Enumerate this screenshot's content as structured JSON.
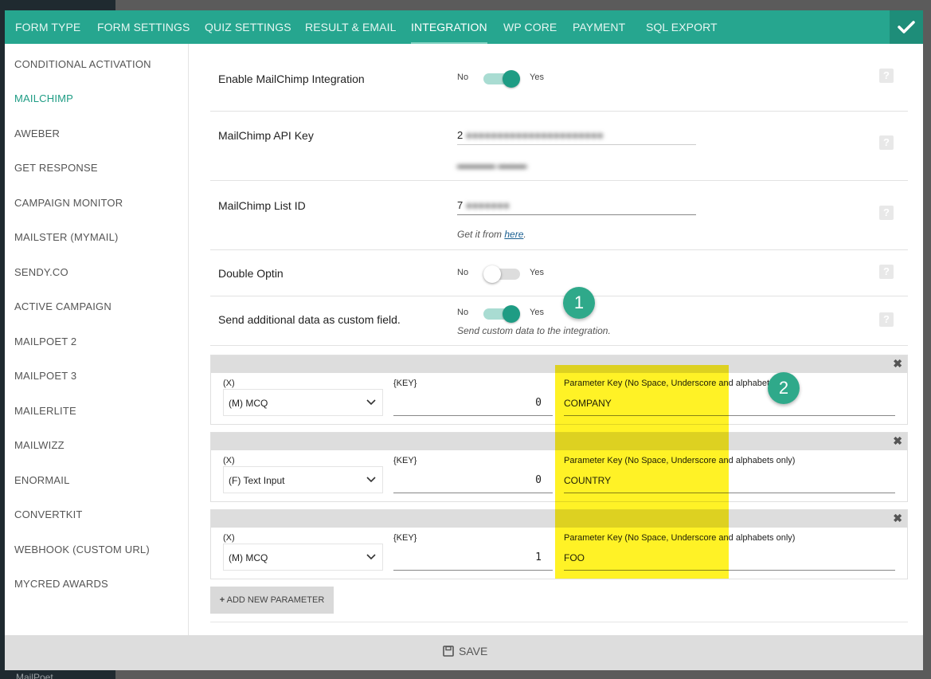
{
  "tabs": [
    {
      "label": "FORM TYPE"
    },
    {
      "label": "FORM SETTINGS"
    },
    {
      "label": "QUIZ SETTINGS"
    },
    {
      "label": "RESULT & EMAIL"
    },
    {
      "label": "INTEGRATION",
      "active": true
    },
    {
      "label": "WP CORE"
    },
    {
      "label": "PAYMENT"
    },
    {
      "label": "SQL EXPORT"
    }
  ],
  "confirm_icon": "check-icon",
  "sidebar": {
    "active": "MAILCHIMP",
    "items": [
      {
        "label": "CONDITIONAL ACTIVATION"
      },
      {
        "label": "MAILCHIMP"
      },
      {
        "label": "AWEBER"
      },
      {
        "label": "GET RESPONSE"
      },
      {
        "label": "CAMPAIGN MONITOR"
      },
      {
        "label": "MAILSTER (MYMAIL)"
      },
      {
        "label": "SENDY.CO"
      },
      {
        "label": "ACTIVE CAMPAIGN"
      },
      {
        "label": "MAILPOET 2"
      },
      {
        "label": "MAILPOET 3"
      },
      {
        "label": "MAILERLITE"
      },
      {
        "label": "MAILWIZZ"
      },
      {
        "label": "ENORMAIL"
      },
      {
        "label": "CONVERTKIT"
      },
      {
        "label": "WEBHOOK (CUSTOM URL)"
      },
      {
        "label": "MYCRED AWARDS"
      }
    ]
  },
  "settings": {
    "enable": {
      "label": "Enable MailChimp Integration",
      "no": "No",
      "yes": "Yes",
      "value": true
    },
    "api_key": {
      "label": "MailChimp API Key",
      "value": "2"
    },
    "list_id": {
      "label": "MailChimp List ID",
      "value": "7",
      "helper_prefix": "Get it from ",
      "helper_link": "here",
      "helper_suffix": "."
    },
    "double_optin": {
      "label": "Double Optin",
      "no": "No",
      "yes": "Yes",
      "value": false
    },
    "custom_field": {
      "label": "Send additional data as custom field.",
      "no": "No",
      "yes": "Yes",
      "value": true,
      "helper": "Send custom data to the integration."
    }
  },
  "parameters": {
    "x_label": "(X)",
    "key_label": "{KEY}",
    "param_label": "Parameter Key (No Space, Underscore and alphabets only)",
    "close": "✖",
    "items": [
      {
        "select": "(M) MCQ",
        "key": "0",
        "param": "COMPANY"
      },
      {
        "select": "(F) Text Input",
        "key": "0",
        "param": "COUNTRY"
      },
      {
        "select": "(M) MCQ",
        "key": "1",
        "param": "FOO"
      }
    ]
  },
  "add_parameter": "ADD NEW PARAMETER",
  "save": "SAVE",
  "markers": [
    "1",
    "2"
  ],
  "backdrop_text": "MailPoet",
  "colors": {
    "accent": "#26a68f",
    "highlight": "#fff000"
  }
}
